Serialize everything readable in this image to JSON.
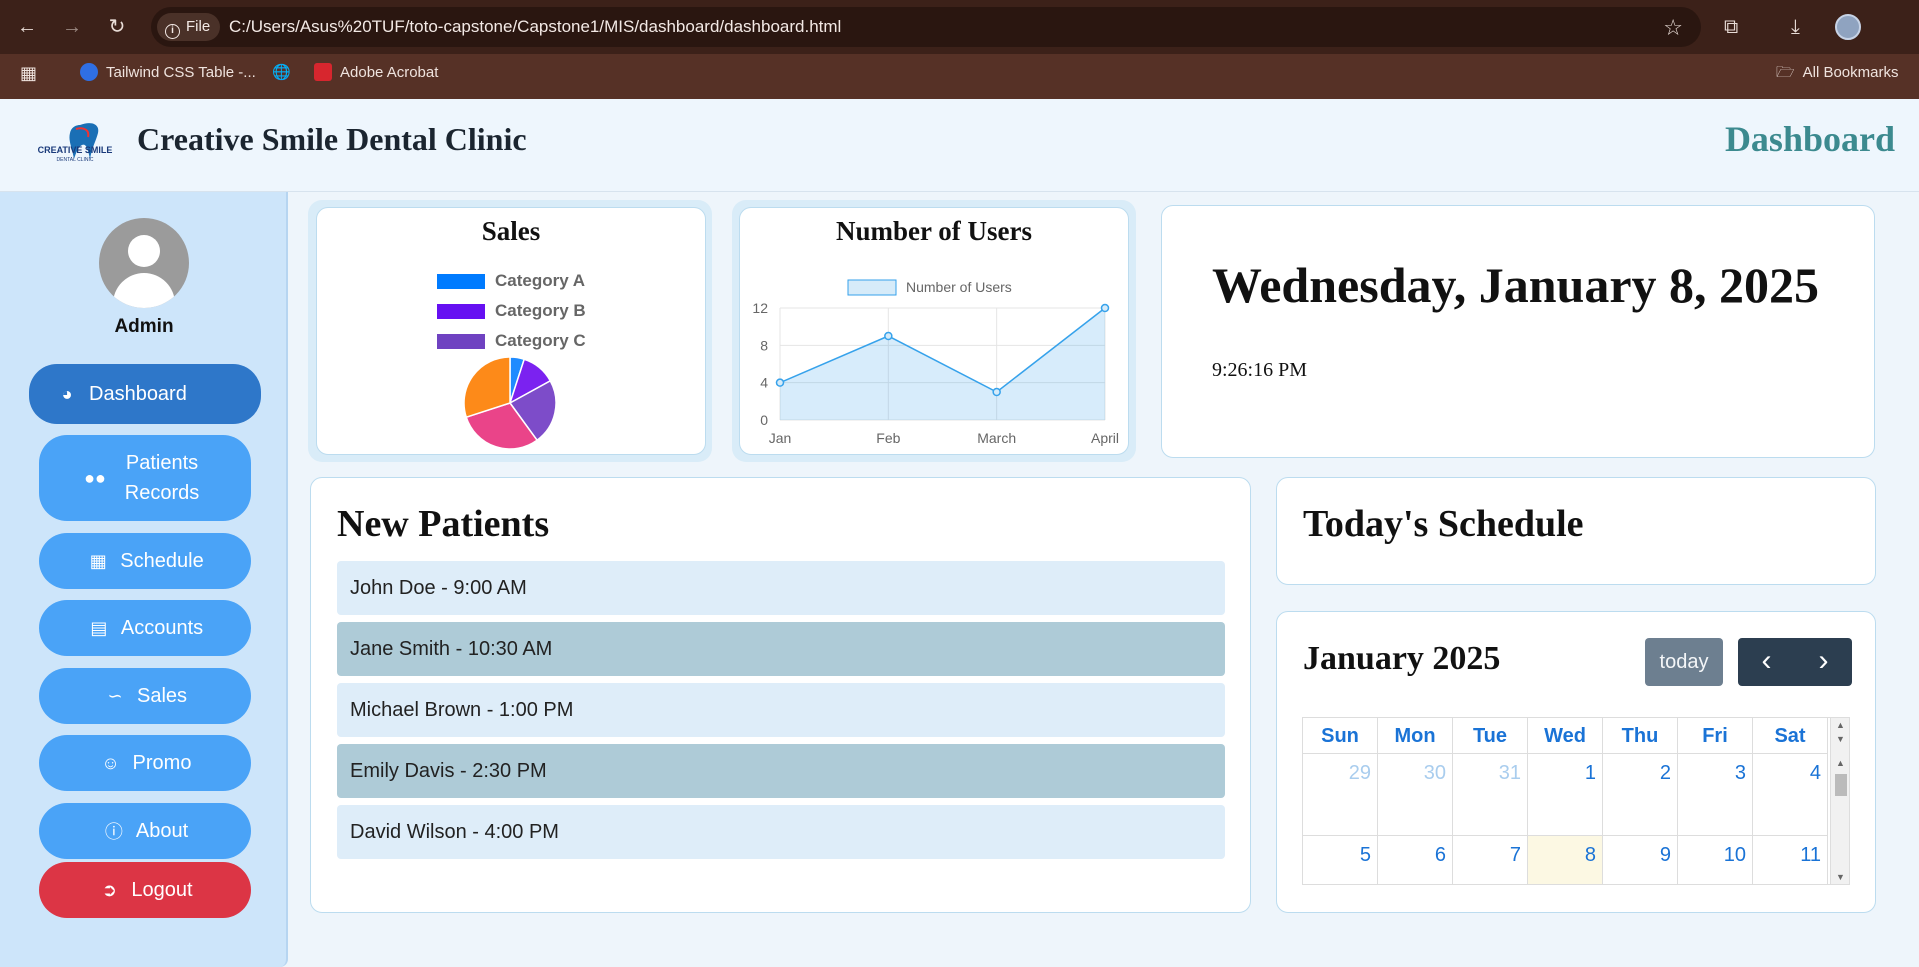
{
  "browser": {
    "file_chip": "File",
    "url": "C:/Users/Asus%20TUF/toto-capstone/Capstone1/MIS/dashboard/dashboard.html",
    "bookmarks": [
      "Tailwind CSS Table -...",
      "Adobe Acrobat"
    ],
    "all_bookmarks": "All Bookmarks"
  },
  "header": {
    "clinic_name": "Creative Smile Dental Clinic",
    "page_title": "Dashboard",
    "logo_text": "CREATIVE SMILE",
    "logo_sub": "DENTAL CLINIC"
  },
  "sidebar": {
    "user_name": "Admin",
    "items": [
      {
        "label": "Dashboard",
        "icon": "gauge-icon"
      },
      {
        "label_line1": "Patients",
        "label_line2": "Records",
        "icon": "users-icon"
      },
      {
        "label": "Schedule",
        "icon": "calendar-icon"
      },
      {
        "label": "Accounts",
        "icon": "invoice-icon"
      },
      {
        "label": "Sales",
        "icon": "chart-line-icon"
      },
      {
        "label": "Promo",
        "icon": "smile-icon"
      },
      {
        "label": "About",
        "icon": "info-icon"
      },
      {
        "label": "Logout",
        "icon": "sign-out-icon"
      }
    ]
  },
  "chart_data": [
    {
      "type": "pie",
      "title": "Sales",
      "categories": [
        "Category A",
        "Category B",
        "Category C"
      ],
      "colors": [
        "#007bff",
        "#6610f2",
        "#6f42c1"
      ],
      "visible_slices": [
        {
          "color": "#1f8bff",
          "value": 5
        },
        {
          "color": "#7b22f0",
          "value": 12
        },
        {
          "color": "#7d4cc9",
          "value": 23
        },
        {
          "color": "#ea4489",
          "value": 30
        },
        {
          "color": "#fd8a19",
          "value": 30
        }
      ]
    },
    {
      "type": "line",
      "title": "Number of Users",
      "series": [
        {
          "name": "Number of Users",
          "values": [
            4,
            9,
            3,
            12
          ]
        }
      ],
      "categories": [
        "Jan",
        "Feb",
        "March",
        "April"
      ],
      "ylim": [
        0,
        12
      ],
      "yticks": [
        0,
        4,
        8,
        12
      ],
      "fill": true,
      "color": "#36a2eb"
    }
  ],
  "datetime": {
    "date": "Wednesday, January 8, 2025",
    "time": "9:26:16 PM"
  },
  "new_patients": {
    "title": "New Patients",
    "rows": [
      "John Doe - 9:00 AM",
      "Jane Smith - 10:30 AM",
      "Michael Brown - 1:00 PM",
      "Emily Davis - 2:30 PM",
      "David Wilson - 4:00 PM"
    ]
  },
  "schedule": {
    "title": "Today's Schedule"
  },
  "calendar": {
    "month_label": "January 2025",
    "today_label": "today",
    "prev_icon": "chevron-left-icon",
    "next_icon": "chevron-right-icon",
    "weekdays": [
      "Sun",
      "Mon",
      "Tue",
      "Wed",
      "Thu",
      "Fri",
      "Sat"
    ],
    "week1": [
      "29",
      "30",
      "31",
      "1",
      "2",
      "3",
      "4"
    ],
    "week2": [
      "5",
      "6",
      "7",
      "8",
      "9",
      "10",
      "11"
    ]
  }
}
